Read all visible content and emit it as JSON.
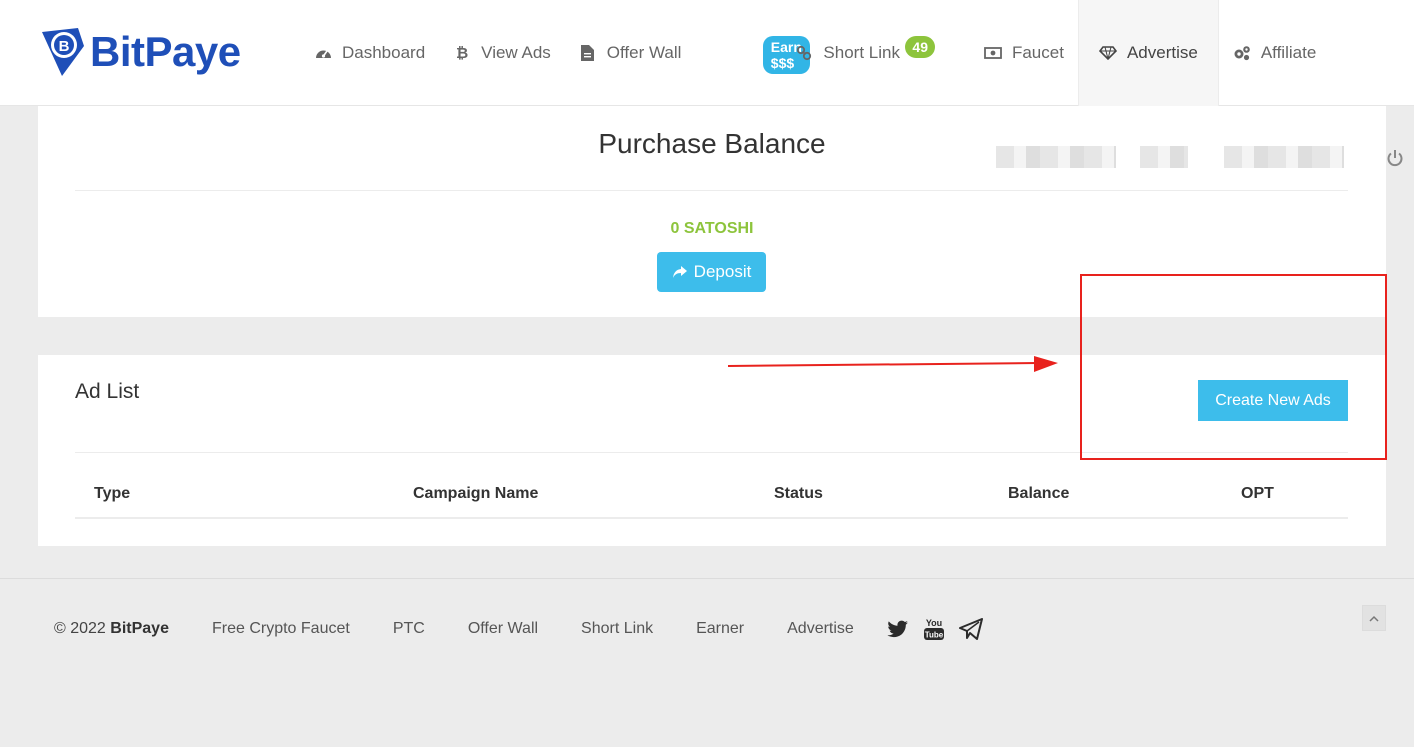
{
  "brand": {
    "name": "BitPaye"
  },
  "nav": {
    "items": [
      {
        "label": "Dashboard",
        "icon": "dashboard-icon"
      },
      {
        "label": "View Ads",
        "icon": "bitcoin-icon"
      },
      {
        "label": "Offer Wall",
        "icon": "document-icon",
        "badge": "Earn $$$"
      },
      {
        "label": "Short Link",
        "icon": "link-icon",
        "badge": "49"
      },
      {
        "label": "Faucet",
        "icon": "money-icon"
      },
      {
        "label": "Advertise",
        "icon": "diamond-icon",
        "active": true
      },
      {
        "label": "Affiliate",
        "icon": "gears-icon"
      }
    ]
  },
  "purchase": {
    "title": "Purchase Balance",
    "amount": "0 SATOSHI",
    "deposit_label": "Deposit"
  },
  "adlist": {
    "title": "Ad List",
    "create_label": "Create New Ads",
    "columns": [
      "Type",
      "Campaign Name",
      "Status",
      "Balance",
      "OPT"
    ]
  },
  "footer": {
    "copyright_prefix": "© 2022 ",
    "copyright_brand": "BitPaye",
    "links": [
      "Free Crypto Faucet",
      "PTC",
      "Offer Wall",
      "Short Link",
      "Earner",
      "Advertise"
    ],
    "social": [
      "twitter-icon",
      "youtube-icon",
      "telegram-icon"
    ]
  },
  "colors": {
    "brand_blue": "#1f4fb8",
    "accent": "#3dbdeb",
    "success": "#8dc43c",
    "annotation_red": "#e8221d"
  }
}
